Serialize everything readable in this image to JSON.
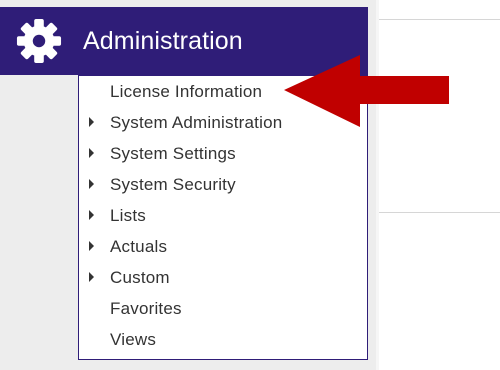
{
  "header": {
    "title": "Administration",
    "icon": "gear-icon",
    "background_color": "#2f1d78",
    "text_color": "#ffffff"
  },
  "menu": {
    "items": [
      {
        "label": "License Information",
        "has_submenu": false
      },
      {
        "label": "System Administration",
        "has_submenu": true
      },
      {
        "label": "System Settings",
        "has_submenu": true
      },
      {
        "label": "System Security",
        "has_submenu": true
      },
      {
        "label": "Lists",
        "has_submenu": true
      },
      {
        "label": "Actuals",
        "has_submenu": true
      },
      {
        "label": "Custom",
        "has_submenu": true
      },
      {
        "label": "Favorites",
        "has_submenu": false
      },
      {
        "label": "Views",
        "has_submenu": false
      }
    ]
  },
  "annotation": {
    "icon": "red-arrow-icon",
    "color": "#c00000",
    "points_to": "License Information"
  }
}
